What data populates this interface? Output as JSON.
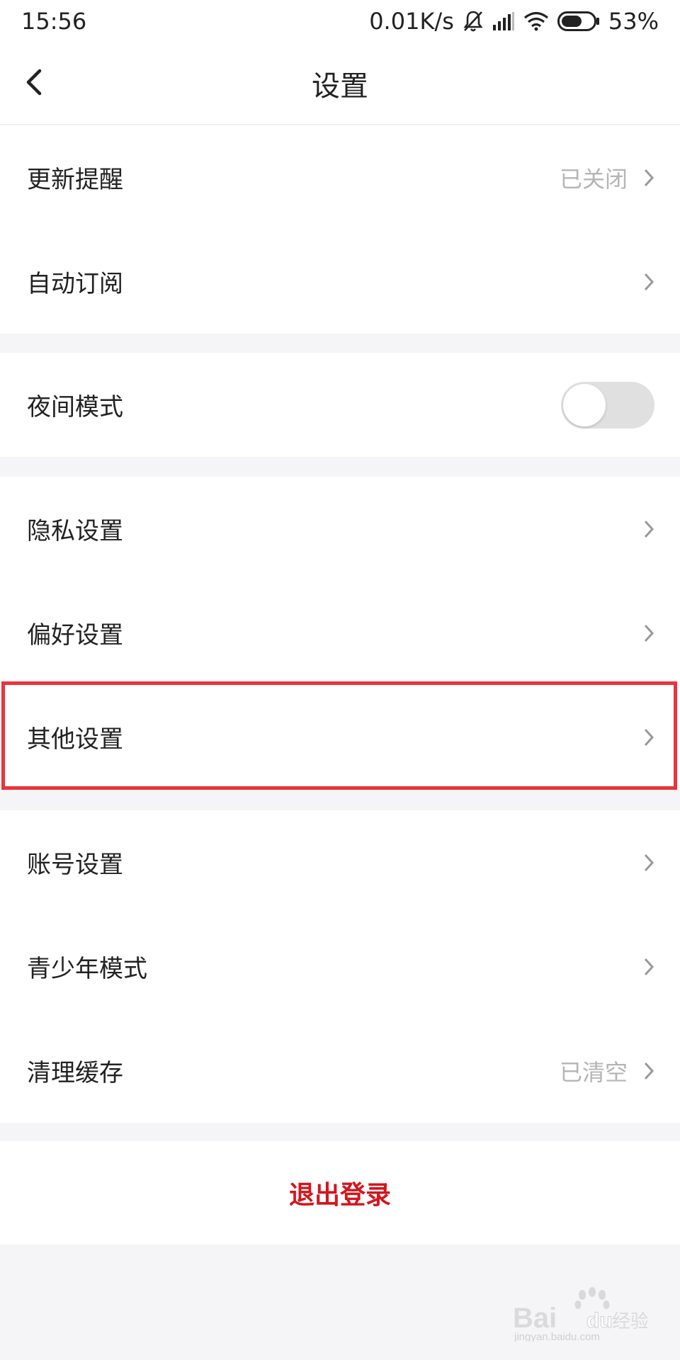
{
  "status_bar": {
    "time": "15:56",
    "network_speed": "0.01K/s",
    "battery": "53%",
    "icons": [
      "mute-bell-icon",
      "signal-icon",
      "wifi-icon",
      "battery-icon"
    ]
  },
  "header": {
    "title": "设置",
    "back_icon": "chevron-left-icon"
  },
  "groups": [
    {
      "items": [
        {
          "label": "更新提醒",
          "value": "已关闭",
          "type": "link"
        },
        {
          "label": "自动订阅",
          "value": "",
          "type": "link"
        }
      ]
    },
    {
      "items": [
        {
          "label": "夜间模式",
          "type": "toggle",
          "toggle_on": false
        }
      ]
    },
    {
      "items": [
        {
          "label": "隐私设置",
          "type": "link"
        },
        {
          "label": "偏好设置",
          "type": "link"
        },
        {
          "label": "其他设置",
          "type": "link",
          "highlighted": true
        }
      ]
    },
    {
      "items": [
        {
          "label": "账号设置",
          "type": "link"
        },
        {
          "label": "青少年模式",
          "type": "link"
        },
        {
          "label": "清理缓存",
          "value": "已清空",
          "type": "link"
        }
      ]
    }
  ],
  "logout_label": "退出登录",
  "colors": {
    "accent_red": "#d3161c",
    "highlight_border": "#e8353b",
    "background": "#f5f5f7",
    "secondary_text": "#b5b5b5"
  },
  "watermark": {
    "brand": "Baidu经验",
    "url": "jingyan.baidu.com"
  }
}
